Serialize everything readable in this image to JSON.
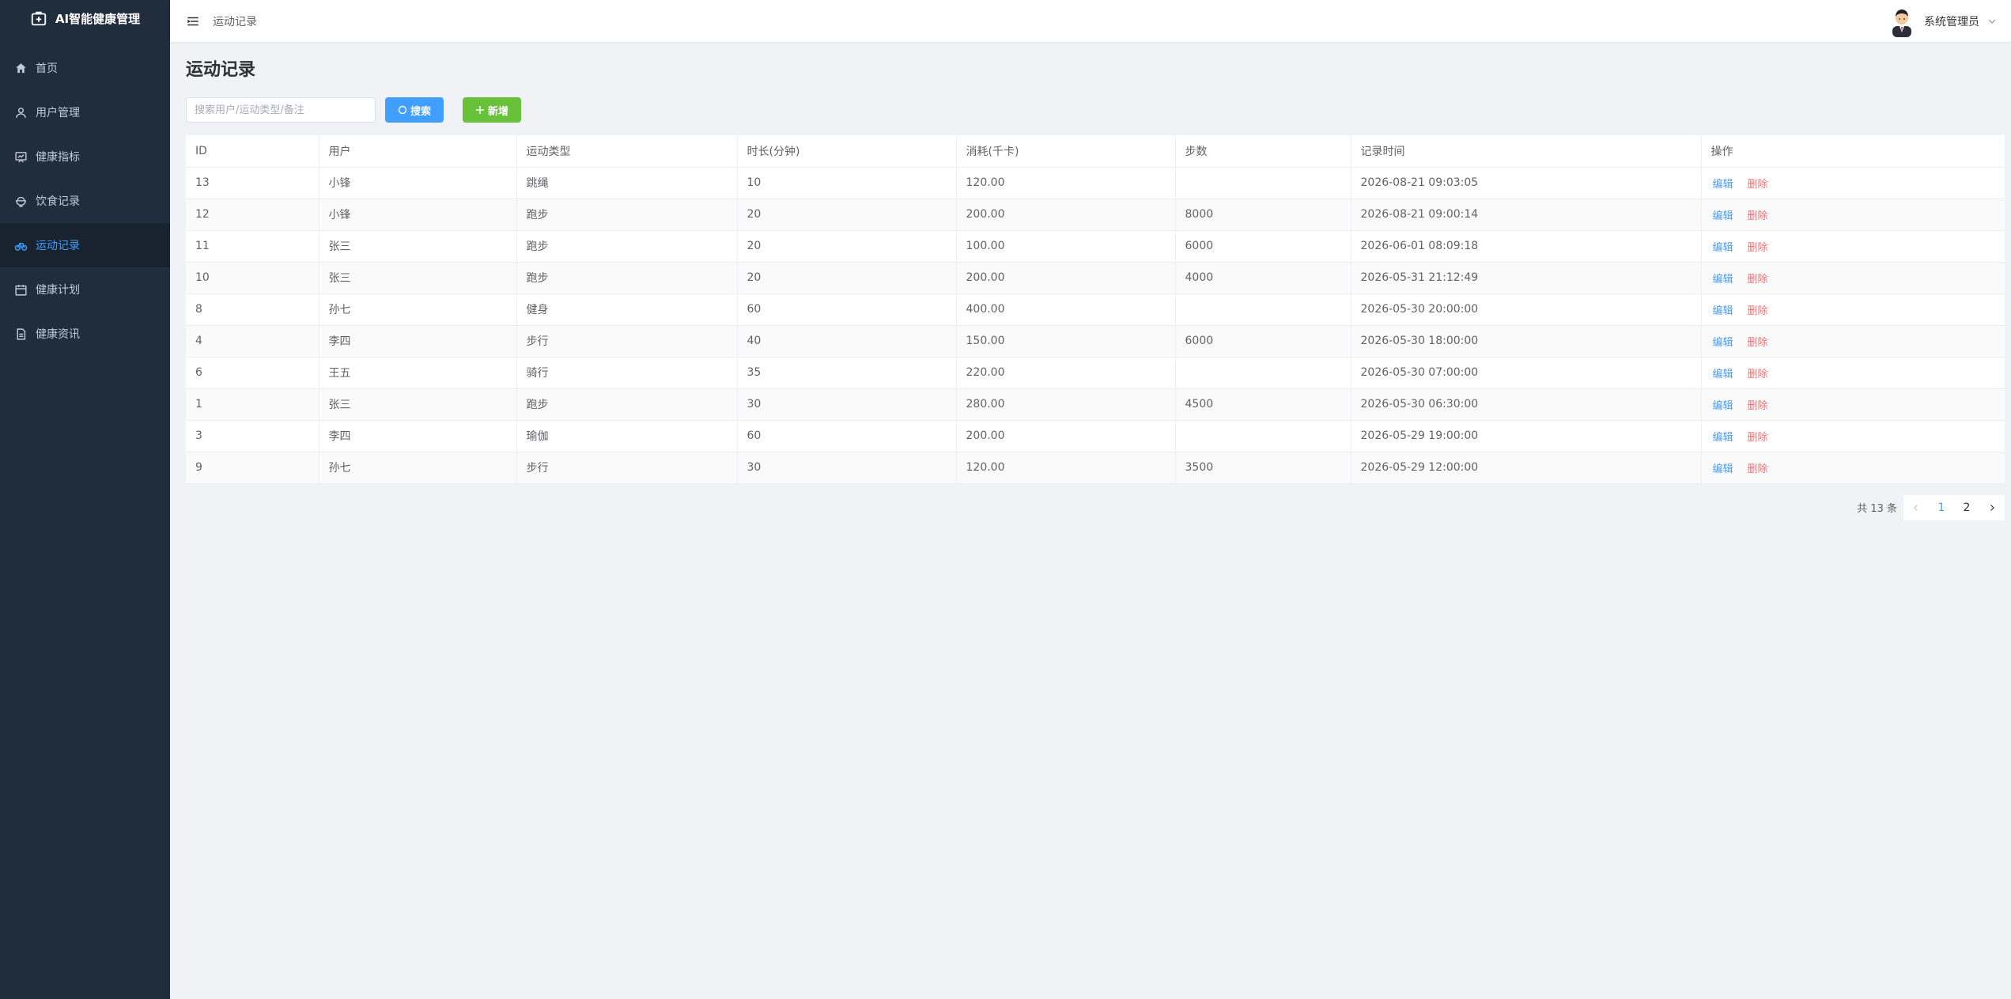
{
  "app": {
    "title": "AI智能健康管理"
  },
  "sidebar": {
    "items": [
      {
        "label": "首页",
        "icon": "home-icon",
        "active": false
      },
      {
        "label": "用户管理",
        "icon": "user-icon",
        "active": false
      },
      {
        "label": "健康指标",
        "icon": "chart-board-icon",
        "active": false
      },
      {
        "label": "饮食记录",
        "icon": "bowl-icon",
        "active": false
      },
      {
        "label": "运动记录",
        "icon": "bicycle-icon",
        "active": true
      },
      {
        "label": "健康计划",
        "icon": "calendar-icon",
        "active": false
      },
      {
        "label": "健康资讯",
        "icon": "document-icon",
        "active": false
      }
    ]
  },
  "header": {
    "breadcrumb": "运动记录",
    "username": "系统管理员"
  },
  "page": {
    "title": "运动记录"
  },
  "toolbar": {
    "search_placeholder": "搜索用户/运动类型/备注",
    "search_label": "搜索",
    "add_label": "新增"
  },
  "table": {
    "columns": [
      "ID",
      "用户",
      "运动类型",
      "时长(分钟)",
      "消耗(千卡)",
      "步数",
      "记录时间",
      "操作"
    ],
    "rows": [
      [
        "13",
        "小锋",
        "跳绳",
        "10",
        "120.00",
        "",
        "2026-08-21 09:03:05"
      ],
      [
        "12",
        "小锋",
        "跑步",
        "20",
        "200.00",
        "8000",
        "2026-08-21 09:00:14"
      ],
      [
        "11",
        "张三",
        "跑步",
        "20",
        "100.00",
        "6000",
        "2026-06-01 08:09:18"
      ],
      [
        "10",
        "张三",
        "跑步",
        "20",
        "200.00",
        "4000",
        "2026-05-31 21:12:49"
      ],
      [
        "8",
        "孙七",
        "健身",
        "60",
        "400.00",
        "",
        "2026-05-30 20:00:00"
      ],
      [
        "4",
        "李四",
        "步行",
        "40",
        "150.00",
        "6000",
        "2026-05-30 18:00:00"
      ],
      [
        "6",
        "王五",
        "骑行",
        "35",
        "220.00",
        "",
        "2026-05-30 07:00:00"
      ],
      [
        "1",
        "张三",
        "跑步",
        "30",
        "280.00",
        "4500",
        "2026-05-30 06:30:00"
      ],
      [
        "3",
        "李四",
        "瑜伽",
        "60",
        "200.00",
        "",
        "2026-05-29 19:00:00"
      ],
      [
        "9",
        "孙七",
        "步行",
        "30",
        "120.00",
        "3500",
        "2026-05-29 12:00:00"
      ]
    ],
    "edit_label": "编辑",
    "delete_label": "删除"
  },
  "pagination": {
    "total_text": "共 13 条",
    "pages": [
      "1",
      "2"
    ],
    "current": "1"
  },
  "colors": {
    "sidebar_bg": "#1f2d3d",
    "primary": "#409eff",
    "success": "#67c23a",
    "danger": "#f56c6c"
  }
}
